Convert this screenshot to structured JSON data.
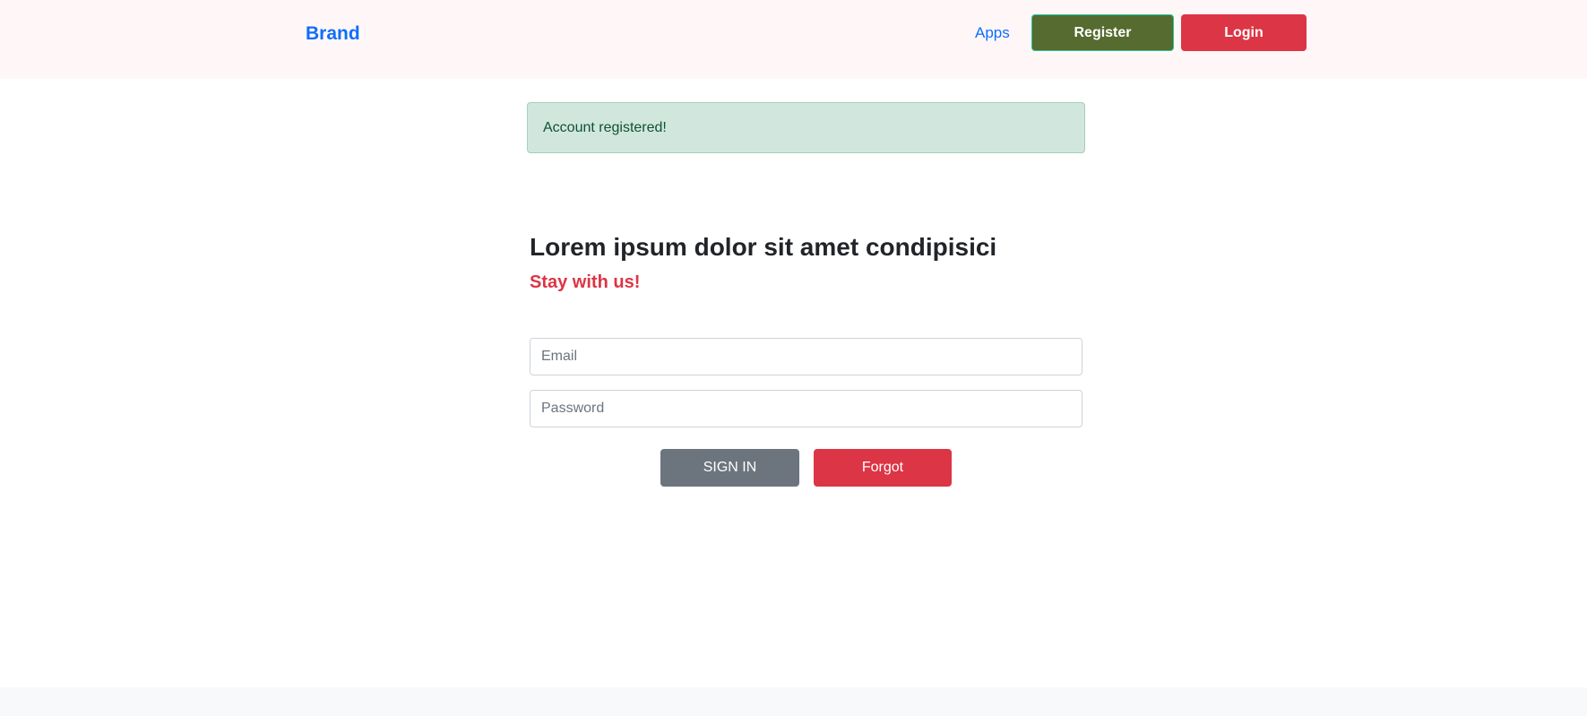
{
  "navbar": {
    "brand": "Brand",
    "apps_link": "Apps",
    "register_label": "Register",
    "login_label": "Login"
  },
  "alert": {
    "message": "Account registered!"
  },
  "main": {
    "title": "Lorem ipsum dolor sit amet condipisici",
    "subtitle": "Stay with us!"
  },
  "form": {
    "email_placeholder": "Email",
    "email_value": "",
    "password_placeholder": "Password",
    "password_value": "",
    "signin_label": "SIGN IN",
    "forgot_label": "Forgot"
  },
  "colors": {
    "navbar_bg": "#fff7f7",
    "brand": "#0d6efd",
    "register_bg": "#556b2f",
    "register_border": "#20c997",
    "danger": "#dc3545",
    "alert_bg": "#d1e7dd",
    "alert_text": "#0f5132",
    "secondary": "#6c757d",
    "footer_bg": "#f8f9fa"
  }
}
